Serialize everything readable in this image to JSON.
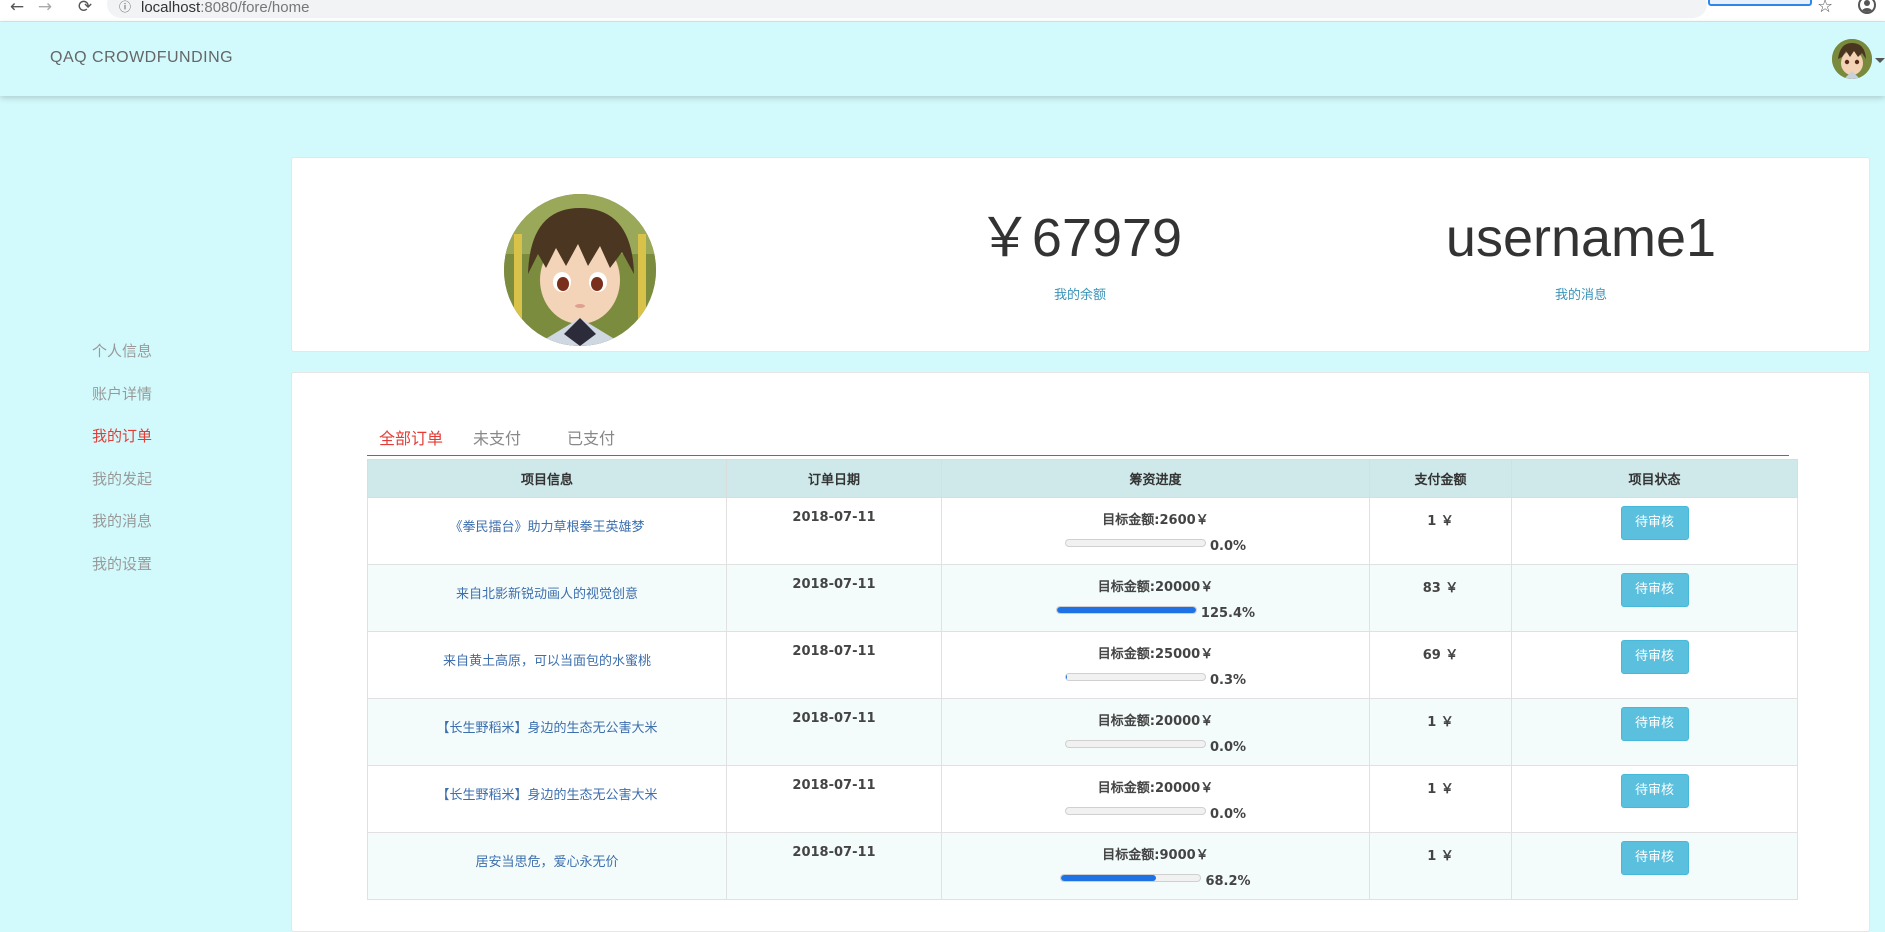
{
  "browser": {
    "url_host": "localhost",
    "url_rest": ":8080/fore/home",
    "back_glyph": "←",
    "forward_glyph": "→",
    "reload_glyph": "⟳",
    "info_glyph": "ⓘ",
    "star_glyph": "☆"
  },
  "header": {
    "brand": "QAQ CROWDFUNDING"
  },
  "sidebar": {
    "items": [
      {
        "label": "个人信息"
      },
      {
        "label": "账户详情"
      },
      {
        "label": "我的订单"
      },
      {
        "label": "我的发起"
      },
      {
        "label": "我的消息"
      },
      {
        "label": "我的设置"
      }
    ],
    "active_index": 2
  },
  "profile": {
    "balance_value": "￥67979",
    "balance_label": "我的余额",
    "username": "username1",
    "message_label": "我的消息"
  },
  "orders": {
    "tabs": [
      {
        "label": "全部订单"
      },
      {
        "label": "未支付"
      },
      {
        "label": "已支付"
      }
    ],
    "active_tab": 0,
    "columns": [
      "项目信息",
      "订单日期",
      "筹资进度",
      "支付金额",
      "项目状态"
    ],
    "rows": [
      {
        "project": "《拳民擂台》助力草根拳王英雄梦",
        "date": "2018-07-11",
        "goal": "目标金额:2600￥",
        "progress": 0.0,
        "progress_text": "0.0%",
        "amount": "1 ￥",
        "status": "待审核"
      },
      {
        "project": "来自北影新锐动画人的视觉创意",
        "date": "2018-07-11",
        "goal": "目标金额:20000￥",
        "progress": 125.4,
        "progress_text": "125.4%",
        "amount": "83 ￥",
        "status": "待审核"
      },
      {
        "project": "来自黄土高原，可以当面包的水蜜桃",
        "date": "2018-07-11",
        "goal": "目标金额:25000￥",
        "progress": 0.3,
        "progress_text": "0.3%",
        "amount": "69 ￥",
        "status": "待审核"
      },
      {
        "project": "【长生野稻米】身边的生态无公害大米",
        "date": "2018-07-11",
        "goal": "目标金额:20000￥",
        "progress": 0.0,
        "progress_text": "0.0%",
        "amount": "1 ￥",
        "status": "待审核"
      },
      {
        "project": "【长生野稻米】身边的生态无公害大米",
        "date": "2018-07-11",
        "goal": "目标金额:20000￥",
        "progress": 0.0,
        "progress_text": "0.0%",
        "amount": "1 ￥",
        "status": "待审核"
      },
      {
        "project": "居安当思危，爱心永无价",
        "date": "2018-07-11",
        "goal": "目标金额:9000￥",
        "progress": 68.2,
        "progress_text": "68.2%",
        "amount": "1 ￥",
        "status": "待审核"
      }
    ]
  },
  "colors": {
    "page_bg": "#d2fafc",
    "accent_red": "#e33c36",
    "link_blue": "#3d6fae",
    "progress_blue": "#1e72e6",
    "status_btn": "#5bc0de",
    "table_header": "#cfe8ea"
  },
  "icons": {
    "header_avatar": "anime-avatar-icon",
    "dropdown": "caret-down-icon"
  }
}
